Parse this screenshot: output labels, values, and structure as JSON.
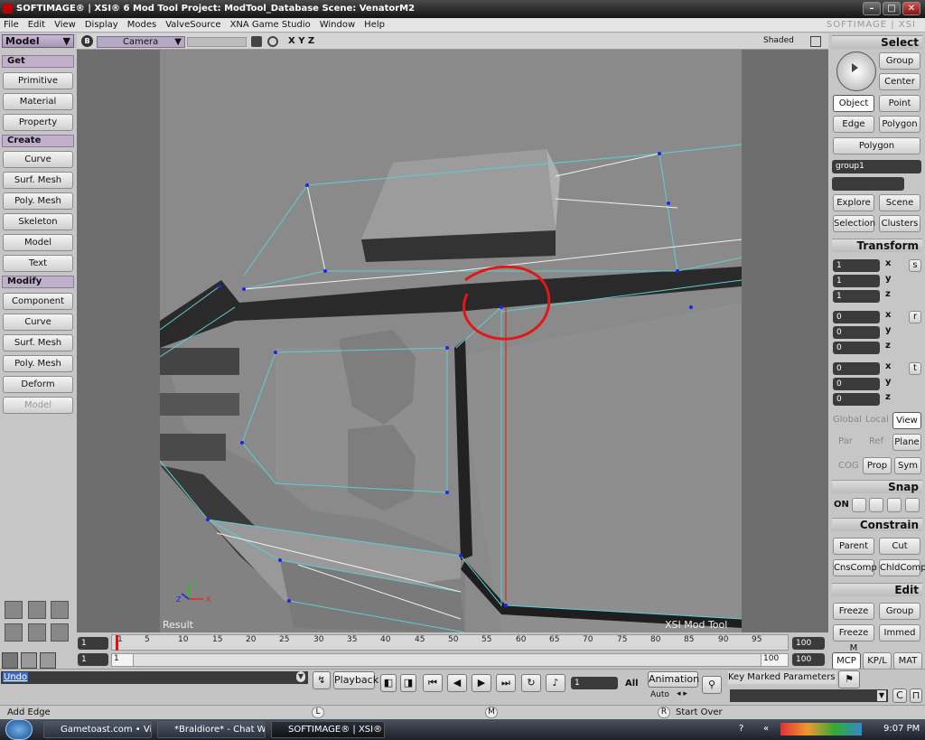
{
  "title": "SOFTIMAGE® | XSI® 6 Mod Tool Project: ModTool_Database    Scene: VenatorM2",
  "menu": [
    "File",
    "Edit",
    "View",
    "Display",
    "Modes",
    "ValveSource",
    "XNA Game Studio",
    "Window",
    "Help"
  ],
  "brand": "SOFTIMAGE | XSI",
  "left": {
    "mode": "Model",
    "get": "Get",
    "get_items": [
      "Primitive",
      "Material",
      "Property"
    ],
    "create": "Create",
    "create_items": [
      "Curve",
      "Surf. Mesh",
      "Poly. Mesh",
      "Skeleton",
      "Model",
      "Text"
    ],
    "modify": "Modify",
    "modify_items": [
      "Component",
      "Curve",
      "Surf. Mesh",
      "Poly. Mesh",
      "Deform",
      "Model"
    ]
  },
  "view": {
    "b": "B",
    "camera": "Camera",
    "xyz": "X Y Z",
    "shaded": "Shaded",
    "result": "Result",
    "footer": "XSI Mod Tool"
  },
  "right": {
    "select": "Select",
    "group": "Group",
    "center": "Center",
    "object": "Object",
    "point": "Point",
    "edge": "Edge",
    "polygon": "Polygon",
    "polygon2": "Polygon",
    "group1": "group1",
    "explore": "Explore",
    "scene": "Scene",
    "selection": "Selection",
    "clusters": "Clusters",
    "transform": "Transform",
    "scl": [
      "1",
      "1",
      "1"
    ],
    "rot": [
      "0",
      "0",
      "0"
    ],
    "pos": [
      "0",
      "0",
      "0"
    ],
    "xl": "x",
    "yl": "y",
    "zl": "z",
    "sl": "s",
    "rl": "r",
    "tl": "t",
    "global": "Global",
    "local": "Local",
    "viewb": "View",
    "par": "Par",
    "ref": "Ref",
    "plane": "Plane",
    "cog": "COG",
    "prop": "Prop",
    "sym": "Sym",
    "snap": "Snap",
    "on": "ON",
    "constrain": "Constrain",
    "parent": "Parent",
    "cut": "Cut",
    "cnscomp": "CnsComp",
    "chldcomp": "ChldComp",
    "edit": "Edit",
    "freeze": "Freeze",
    "group2": "Group",
    "freezem": "Freeze M",
    "immed": "Immed",
    "mcp": "MCP",
    "kpl": "KP/L",
    "mat": "MAT"
  },
  "timeline": {
    "start": "1",
    "start2": "1",
    "current": "1",
    "end": "100",
    "end2": "100",
    "end_label": "100",
    "ticks": [
      "1",
      "5",
      "10",
      "15",
      "20",
      "25",
      "30",
      "35",
      "40",
      "45",
      "50",
      "55",
      "60",
      "65",
      "70",
      "75",
      "80",
      "85",
      "90",
      "95"
    ]
  },
  "bottom": {
    "undo": "Undo",
    "playback": "Playback",
    "frame": "1",
    "all": "All",
    "animation": "Animation",
    "auto": "Auto",
    "keymarked": "Key Marked Parameters",
    "status": "Add Edge",
    "l": "L",
    "m": "M",
    "r": "R",
    "startover": "Start Over"
  },
  "taskbar": {
    "items": [
      "Gametoast.com • View...",
      "*Braldiore* - Chat Wi...",
      "SOFTIMAGE® | XSI® ..."
    ],
    "clock": "9:07 PM"
  }
}
